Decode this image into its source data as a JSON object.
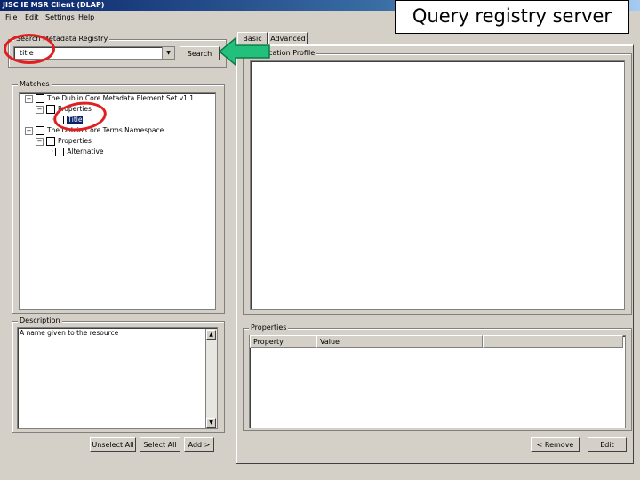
{
  "window": {
    "title": "JISC IE MSR Client (DLAP)"
  },
  "menu": [
    "File",
    "Edit",
    "Settings",
    "Help"
  ],
  "callout": {
    "text": "Query registry server"
  },
  "search": {
    "legend": "Search Metadata Registry",
    "value": "title",
    "button": "Search"
  },
  "matches": {
    "legend": "Matches",
    "rows": [
      {
        "label": "The Dublin Core Metadata Element Set v1.1"
      },
      {
        "label": "Properties"
      },
      {
        "label": "Title",
        "selected": true
      },
      {
        "label": "The Dublin Core Terms Namespace"
      },
      {
        "label": "Properties"
      },
      {
        "label": "Alternative"
      }
    ]
  },
  "description": {
    "legend": "Description",
    "text": "A name given to the resource"
  },
  "left_buttons": {
    "unselect_all": "Unselect All",
    "select_all": "Select All",
    "add": "Add >"
  },
  "tabs": [
    "Basic",
    "Advanced"
  ],
  "profile": {
    "legend": "Application Profile"
  },
  "properties": {
    "legend": "Properties",
    "columns": [
      "Property",
      "Value"
    ]
  },
  "right_buttons": {
    "remove": "< Remove",
    "edit": "Edit"
  },
  "colors": {
    "annotation_red": "#e02020",
    "arrow_green": "#22c07a",
    "title_bar": "#0a246a"
  }
}
